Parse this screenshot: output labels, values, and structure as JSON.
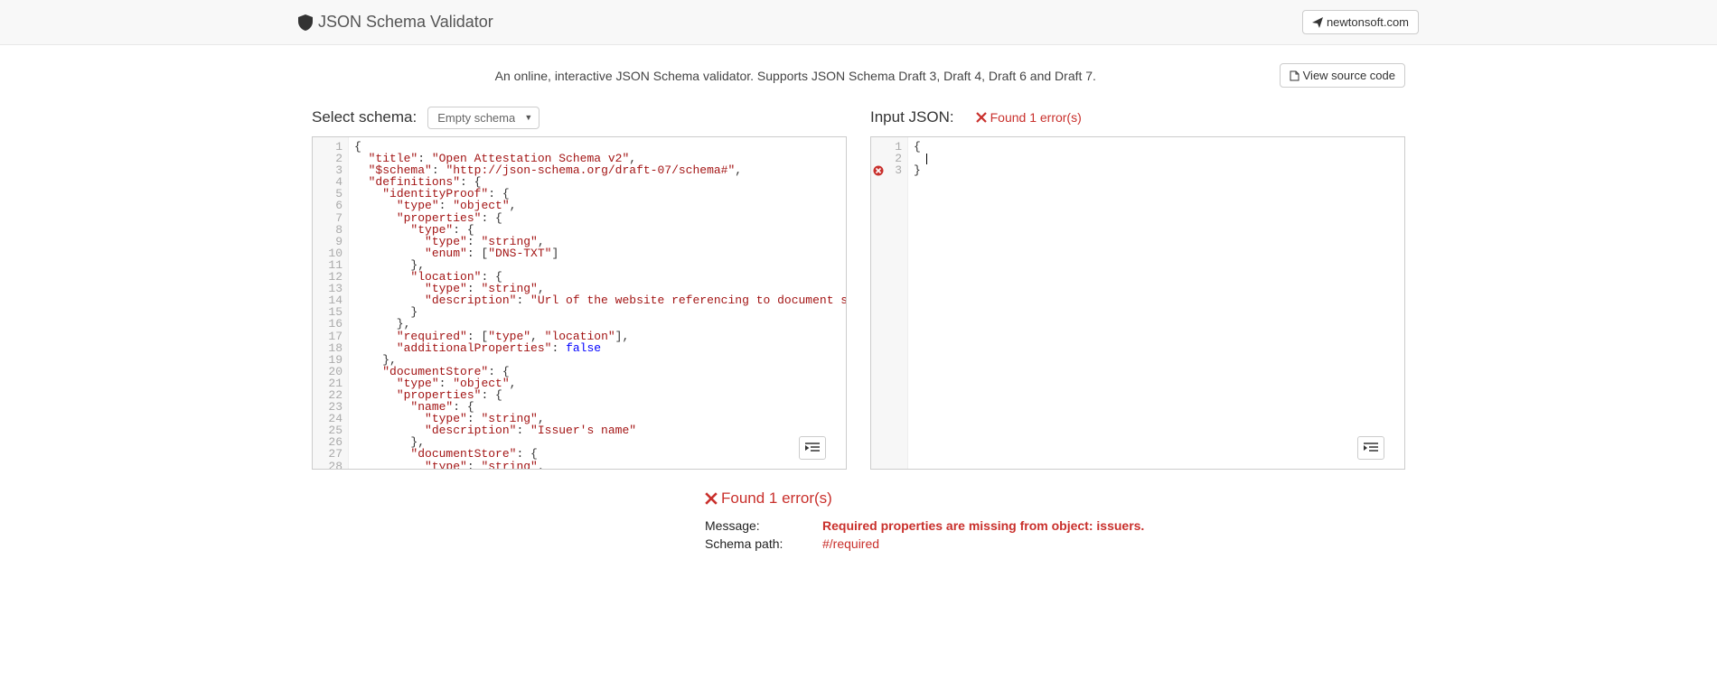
{
  "header": {
    "title": "JSON Schema Validator",
    "external_link": "newtonsoft.com"
  },
  "intro": {
    "text": "An online, interactive JSON Schema validator. Supports JSON Schema Draft 3, Draft 4, Draft 6 and Draft 7.",
    "source_btn": "View source code"
  },
  "left": {
    "label": "Select schema:",
    "select_value": "Empty schema"
  },
  "right": {
    "label": "Input JSON:",
    "error_text": "Found 1 error(s)"
  },
  "schema_lines": [
    [
      [
        "pun",
        "{"
      ]
    ],
    [
      [
        "pun",
        "  "
      ],
      [
        "key",
        "\"title\""
      ],
      [
        "pun",
        ": "
      ],
      [
        "str",
        "\"Open Attestation Schema v2\""
      ],
      [
        "pun",
        ","
      ]
    ],
    [
      [
        "pun",
        "  "
      ],
      [
        "key",
        "\"$schema\""
      ],
      [
        "pun",
        ": "
      ],
      [
        "str",
        "\"http://json-schema.org/draft-07/schema#\""
      ],
      [
        "pun",
        ","
      ]
    ],
    [
      [
        "pun",
        "  "
      ],
      [
        "key",
        "\"definitions\""
      ],
      [
        "pun",
        ": {"
      ]
    ],
    [
      [
        "pun",
        "    "
      ],
      [
        "key",
        "\"identityProof\""
      ],
      [
        "pun",
        ": {"
      ]
    ],
    [
      [
        "pun",
        "      "
      ],
      [
        "key",
        "\"type\""
      ],
      [
        "pun",
        ": "
      ],
      [
        "str",
        "\"object\""
      ],
      [
        "pun",
        ","
      ]
    ],
    [
      [
        "pun",
        "      "
      ],
      [
        "key",
        "\"properties\""
      ],
      [
        "pun",
        ": {"
      ]
    ],
    [
      [
        "pun",
        "        "
      ],
      [
        "key",
        "\"type\""
      ],
      [
        "pun",
        ": {"
      ]
    ],
    [
      [
        "pun",
        "          "
      ],
      [
        "key",
        "\"type\""
      ],
      [
        "pun",
        ": "
      ],
      [
        "str",
        "\"string\""
      ],
      [
        "pun",
        ","
      ]
    ],
    [
      [
        "pun",
        "          "
      ],
      [
        "key",
        "\"enum\""
      ],
      [
        "pun",
        ": ["
      ],
      [
        "str",
        "\"DNS-TXT\""
      ],
      [
        "pun",
        "]"
      ]
    ],
    [
      [
        "pun",
        "        },"
      ]
    ],
    [
      [
        "pun",
        "        "
      ],
      [
        "key",
        "\"location\""
      ],
      [
        "pun",
        ": {"
      ]
    ],
    [
      [
        "pun",
        "          "
      ],
      [
        "key",
        "\"type\""
      ],
      [
        "pun",
        ": "
      ],
      [
        "str",
        "\"string\""
      ],
      [
        "pun",
        ","
      ]
    ],
    [
      [
        "pun",
        "          "
      ],
      [
        "key",
        "\"description\""
      ],
      [
        "pun",
        ": "
      ],
      [
        "str",
        "\"Url of the website referencing to document store\""
      ]
    ],
    [
      [
        "pun",
        "        }"
      ]
    ],
    [
      [
        "pun",
        "      },"
      ]
    ],
    [
      [
        "pun",
        "      "
      ],
      [
        "key",
        "\"required\""
      ],
      [
        "pun",
        ": ["
      ],
      [
        "str",
        "\"type\""
      ],
      [
        "pun",
        ", "
      ],
      [
        "str",
        "\"location\""
      ],
      [
        "pun",
        "],"
      ]
    ],
    [
      [
        "pun",
        "      "
      ],
      [
        "key",
        "\"additionalProperties\""
      ],
      [
        "pun",
        ": "
      ],
      [
        "kw",
        "false"
      ]
    ],
    [
      [
        "pun",
        "    },"
      ]
    ],
    [
      [
        "pun",
        "    "
      ],
      [
        "key",
        "\"documentStore\""
      ],
      [
        "pun",
        ": {"
      ]
    ],
    [
      [
        "pun",
        "      "
      ],
      [
        "key",
        "\"type\""
      ],
      [
        "pun",
        ": "
      ],
      [
        "str",
        "\"object\""
      ],
      [
        "pun",
        ","
      ]
    ],
    [
      [
        "pun",
        "      "
      ],
      [
        "key",
        "\"properties\""
      ],
      [
        "pun",
        ": {"
      ]
    ],
    [
      [
        "pun",
        "        "
      ],
      [
        "key",
        "\"name\""
      ],
      [
        "pun",
        ": {"
      ]
    ],
    [
      [
        "pun",
        "          "
      ],
      [
        "key",
        "\"type\""
      ],
      [
        "pun",
        ": "
      ],
      [
        "str",
        "\"string\""
      ],
      [
        "pun",
        ","
      ]
    ],
    [
      [
        "pun",
        "          "
      ],
      [
        "key",
        "\"description\""
      ],
      [
        "pun",
        ": "
      ],
      [
        "str",
        "\"Issuer's name\""
      ]
    ],
    [
      [
        "pun",
        "        },"
      ]
    ],
    [
      [
        "pun",
        "        "
      ],
      [
        "key",
        "\"documentStore\""
      ],
      [
        "pun",
        ": {"
      ]
    ],
    [
      [
        "pun",
        "          "
      ],
      [
        "key",
        "\"type\""
      ],
      [
        "pun",
        ": "
      ],
      [
        "str",
        "\"string\""
      ],
      [
        "pun",
        ","
      ]
    ]
  ],
  "input_lines": [
    {
      "marker": false,
      "tokens": [
        [
          "pun",
          "{"
        ]
      ]
    },
    {
      "marker": false,
      "tokens": [
        [
          "cursor",
          ""
        ]
      ]
    },
    {
      "marker": true,
      "tokens": [
        [
          "pun",
          "}"
        ]
      ]
    }
  ],
  "results": {
    "found": "Found 1 error(s)",
    "message_label": "Message:",
    "message_value": "Required properties are missing from object: issuers.",
    "path_label": "Schema path:",
    "path_value": "#/required"
  }
}
